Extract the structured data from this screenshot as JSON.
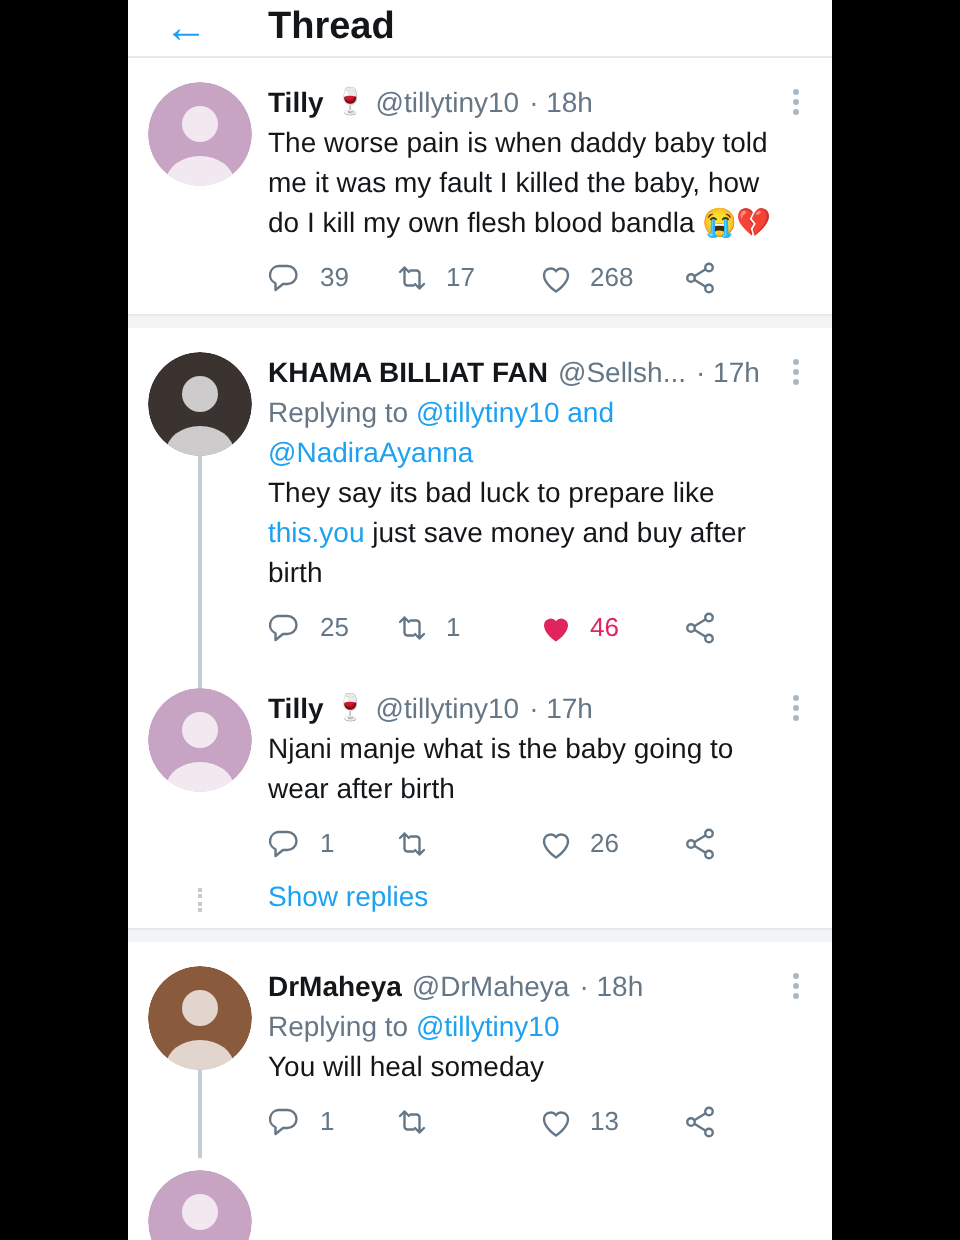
{
  "header": {
    "back": "←",
    "title": "Thread"
  },
  "items": [
    {
      "kind": "tweet",
      "name": "Tilly",
      "emoji": "🍷",
      "handle": "@tillytiny10",
      "time": "· 18h",
      "avatar": {
        "color": "#c7a3c4"
      },
      "line_above": false,
      "line_below": false,
      "text_parts": [
        {
          "text": "The worse pain is when daddy baby told me it was my fault I killed the baby, how do I kill my own flesh blood bandla 😭💔",
          "link": false
        }
      ],
      "replies": "39",
      "retweets": "17",
      "likes": "268",
      "liked": false
    },
    {
      "kind": "divider"
    },
    {
      "kind": "tweet",
      "name": "KHAMA BILLIAT FAN",
      "handle": "@Sellsh...",
      "time": "· 17h",
      "avatar": {
        "color": "#3a3330"
      },
      "line_above": false,
      "line_below": true,
      "replying_label": "Replying to",
      "mentions": [
        "@tillytiny10 and",
        "@NadiraAyanna"
      ],
      "text_parts": [
        {
          "text": "They say its bad luck to prepare like ",
          "link": false
        },
        {
          "text": "this.you",
          "link": true
        },
        {
          "text": " just save money and buy after birth",
          "link": false
        }
      ],
      "replies": "25",
      "retweets": "1",
      "likes": "46",
      "liked": true
    },
    {
      "kind": "tweet",
      "name": "Tilly",
      "emoji": "🍷",
      "handle": "@tillytiny10",
      "time": "· 17h",
      "avatar": {
        "color": "#c7a3c4"
      },
      "line_above": true,
      "line_below": false,
      "text_parts": [
        {
          "text": "Njani manje what is the baby going to wear after birth",
          "link": false
        }
      ],
      "replies": "1",
      "likes": "26",
      "liked": false
    },
    {
      "kind": "show_replies",
      "label": "Show replies"
    },
    {
      "kind": "divider"
    },
    {
      "kind": "tweet",
      "name": "DrMaheya",
      "handle": "@DrMaheya",
      "time": "· 18h",
      "avatar": {
        "color": "#8a5a3c"
      },
      "line_above": false,
      "line_below": true,
      "replying_label": "Replying to",
      "mentions": [
        "@tillytiny10"
      ],
      "text_parts": [
        {
          "text": "You will heal someday",
          "link": false
        }
      ],
      "replies": "1",
      "likes": "13",
      "liked": false
    },
    {
      "kind": "cut_off_tweet",
      "avatar": {
        "color": "#c7a3c4"
      }
    }
  ]
}
